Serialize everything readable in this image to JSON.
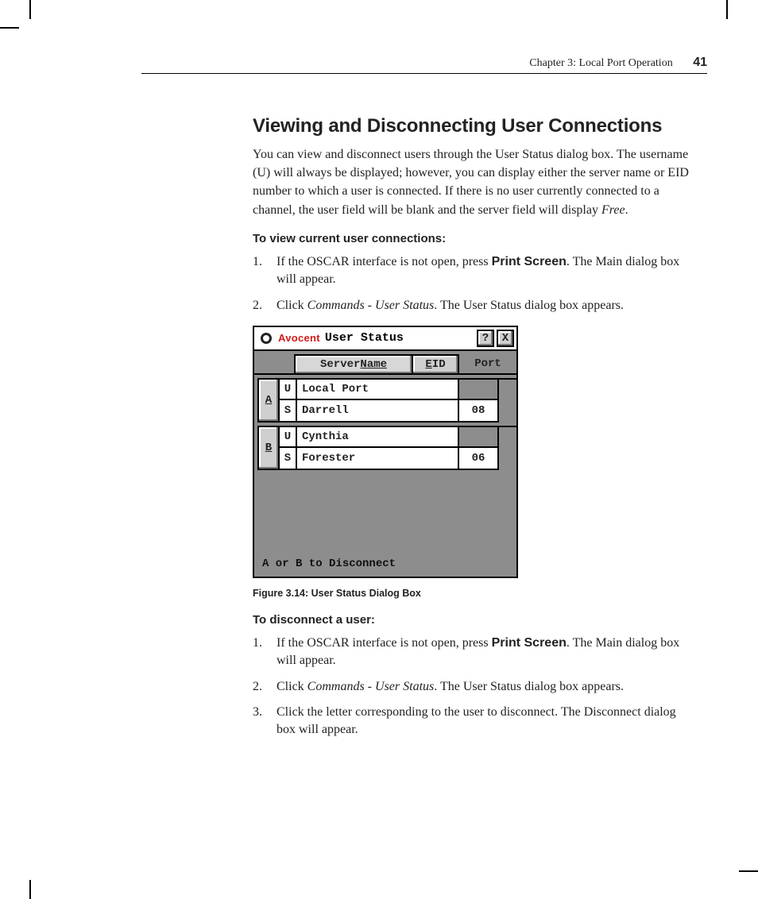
{
  "header": {
    "chapter": "Chapter 3: Local Port Operation",
    "page_number": "41"
  },
  "section": {
    "title": "Viewing and Disconnecting User Connections",
    "intro_a": "You can view and disconnect users through the User Status dialog box. The username (U) will always be displayed; however, you can display either the server name or EID number to which a user is connected. If there is no user currently connected to a channel, the user field will be blank and the server field will display ",
    "intro_free": "Free",
    "intro_b": "."
  },
  "view": {
    "heading": "To view current user connections:",
    "steps": [
      {
        "n": "1.",
        "pre": "If the OSCAR interface is not open, press ",
        "bold": "Print Screen",
        "post": ". The Main dialog box will appear."
      },
      {
        "n": "2.",
        "pre": "Click ",
        "ital": "Commands - User Status",
        "post": ". The User Status dialog box appears."
      }
    ]
  },
  "dialog": {
    "brand": "Avocent",
    "title": "User Status",
    "help": "?",
    "close": "X",
    "col_name": "Name",
    "col_name_prefix": "Server ",
    "col_eid": "EID",
    "col_eid_u": "E",
    "col_port": "Port",
    "rows": [
      {
        "letter": "A",
        "u": "U",
        "name": "Local Port",
        "port": ""
      },
      {
        "letter": "",
        "u": "S",
        "name": "Darrell",
        "port": "08"
      },
      {
        "letter": "B",
        "u": "U",
        "name": "Cynthia",
        "port": ""
      },
      {
        "letter": "",
        "u": "S",
        "name": "Forester",
        "port": "06"
      }
    ],
    "footer": "A or B to Disconnect"
  },
  "caption": "Figure 3.14: User Status Dialog Box",
  "disconnect": {
    "heading": "To disconnect a user:",
    "steps": [
      {
        "n": "1.",
        "pre": "If the OSCAR interface is not open, press ",
        "bold": "Print Screen",
        "post": ". The Main dialog box will appear."
      },
      {
        "n": "2.",
        "pre": "Click ",
        "ital": "Commands - User Status",
        "post": ". The User Status dialog box appears."
      },
      {
        "n": "3.",
        "pre": "Click the letter corresponding to the user to disconnect. The Disconnect dialog box will appear.",
        "bold": "",
        "post": ""
      }
    ]
  }
}
